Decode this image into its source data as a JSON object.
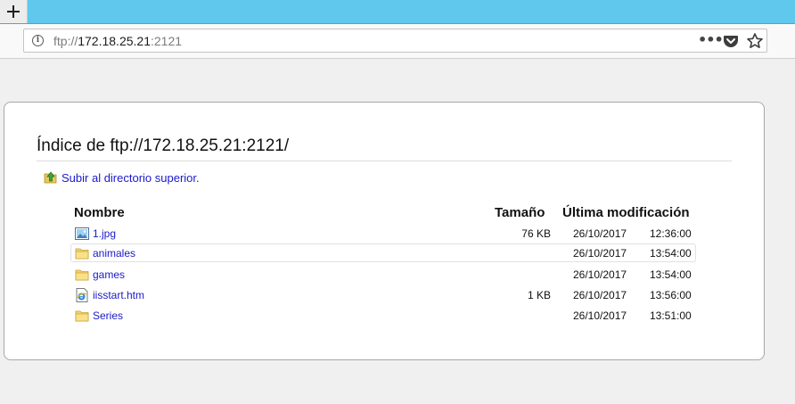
{
  "browser": {
    "new_tab_icon": "plus-icon",
    "url": {
      "scheme": "ftp://",
      "host": "172.18.25.21",
      "port": ":2121"
    },
    "actions": [
      "page-actions-icon",
      "pocket-icon",
      "bookmark-star-icon"
    ]
  },
  "listing": {
    "heading": "Índice de ftp://172.18.25.21:2121/",
    "parent_link": "Subir al directorio superior.",
    "columns": {
      "name": "Nombre",
      "size": "Tamaño",
      "modified": "Última modificación"
    },
    "rows": [
      {
        "name": "1.jpg",
        "type": "image",
        "size": "76 KB",
        "date": "26/10/2017",
        "time": "12:36:00"
      },
      {
        "name": "animales",
        "type": "folder",
        "size": "",
        "date": "26/10/2017",
        "time": "13:54:00"
      },
      {
        "name": "games",
        "type": "folder",
        "size": "",
        "date": "26/10/2017",
        "time": "13:54:00"
      },
      {
        "name": "iisstart.htm",
        "type": "html",
        "size": "1 KB",
        "date": "26/10/2017",
        "time": "13:56:00"
      },
      {
        "name": "Series",
        "type": "folder",
        "size": "",
        "date": "26/10/2017",
        "time": "13:51:00"
      }
    ],
    "link_color": "#1a1acc"
  }
}
